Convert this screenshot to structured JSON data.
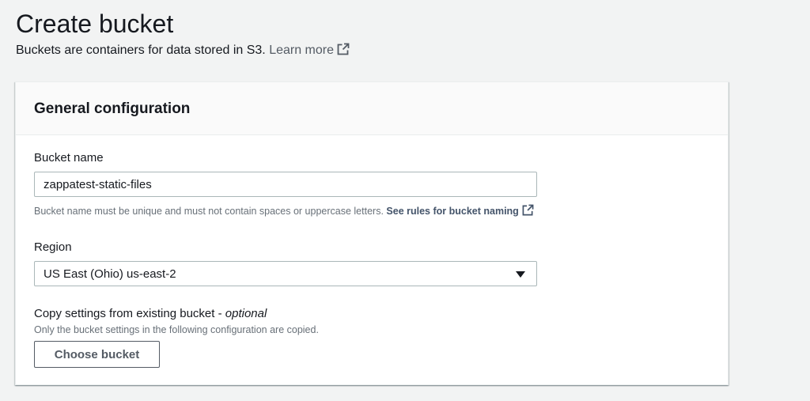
{
  "page": {
    "title": "Create bucket",
    "description": "Buckets are containers for data stored in S3.",
    "learn_more": "Learn more",
    "learn_more_icon": "external-link-icon"
  },
  "general_configuration": {
    "title": "General configuration",
    "bucket_name": {
      "label": "Bucket name",
      "value": "zappatest-static-files",
      "hint": "Bucket name must be unique and must not contain spaces or uppercase letters.",
      "hint_link": "See rules for bucket naming",
      "hint_link_icon": "external-link-icon"
    },
    "region": {
      "label": "Region",
      "selected": "US East (Ohio) us-east-2",
      "icon": "caret-down-icon"
    },
    "copy_settings": {
      "label": "Copy settings from existing bucket - ",
      "label_optional": "optional",
      "description": "Only the bucket settings in the following configuration are copied.",
      "button_label": "Choose bucket"
    }
  },
  "colors": {
    "background": "#f2f3f3",
    "panel": "#ffffff",
    "panel_header": "#fafafa",
    "text": "#16191f",
    "secondary_text": "#687078",
    "link": "#545b64",
    "border": "#aab7b8"
  }
}
